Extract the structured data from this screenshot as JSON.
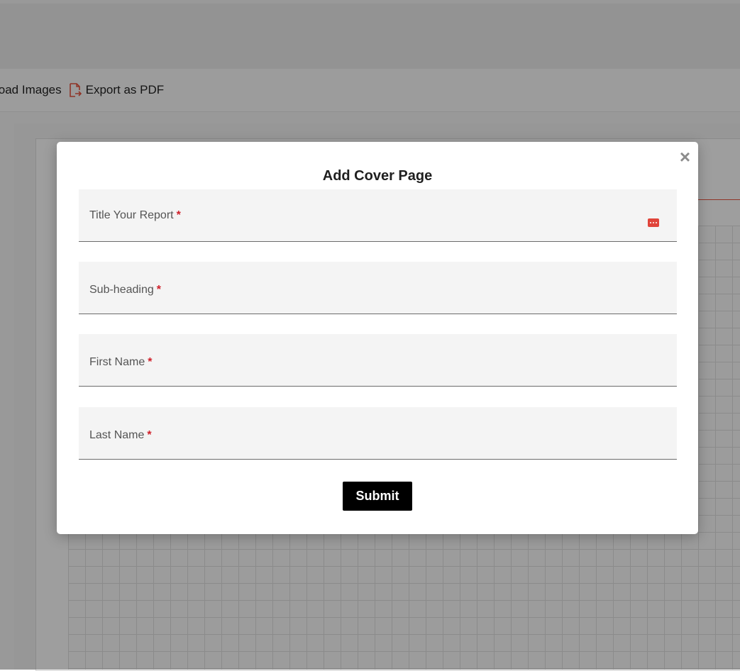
{
  "toolbar": {
    "upload_label": "load Images",
    "export_label": "Export as PDF"
  },
  "modal": {
    "title": "Add Cover Page",
    "close_glyph": "×",
    "fields": [
      {
        "label": "Title Your Report",
        "required": "*",
        "value": "",
        "has_autofill_icon": true
      },
      {
        "label": "Sub-heading",
        "required": "*",
        "value": ""
      },
      {
        "label": "First Name",
        "required": "*",
        "value": ""
      },
      {
        "label": "Last Name",
        "required": "*",
        "value": ""
      }
    ],
    "submit_label": "Submit"
  },
  "colors": {
    "accent_red": "#d0202a",
    "autofill_icon": "#e0443a",
    "pdf_icon": "#e0523d",
    "button_bg": "#000000"
  },
  "icons": {
    "pdf": "export-pdf-icon",
    "close": "close-icon",
    "autofill": "password-manager-icon"
  }
}
